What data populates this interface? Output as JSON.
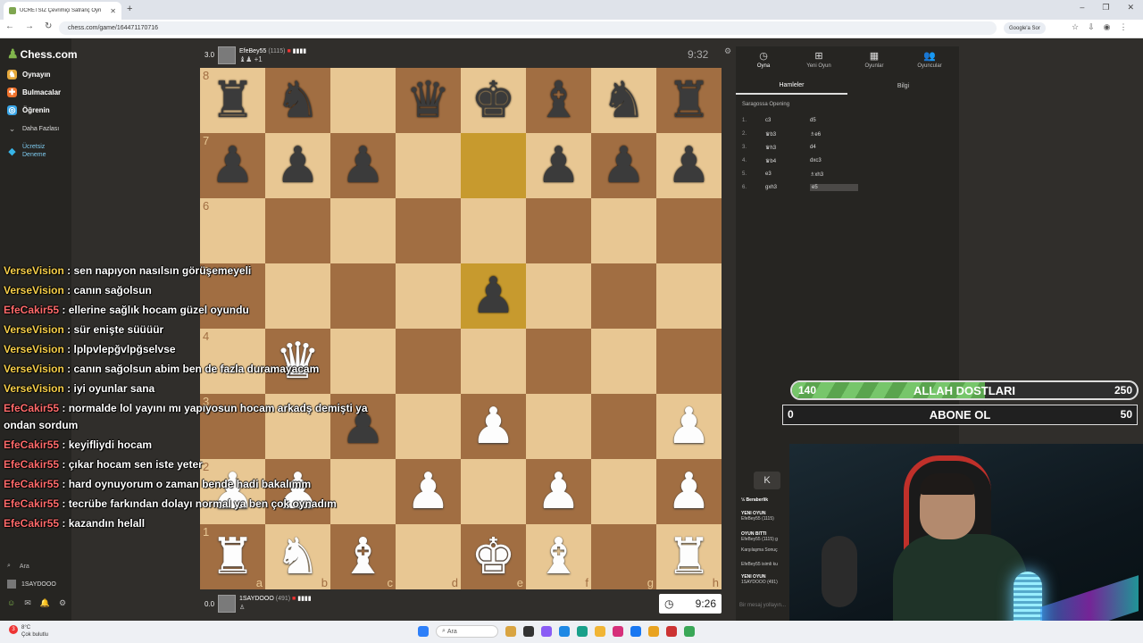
{
  "browser": {
    "tab_title": "ÜCRETSİZ Çevrimiçi Satranç Oyn",
    "new_tab": "+",
    "url": "chess.com/game/164471170716",
    "google_button": "Google'a Sor",
    "window_controls": [
      "–",
      "❐",
      "✕"
    ]
  },
  "sidebar": {
    "logo": "Chess.com",
    "items": [
      {
        "label": "Oynayın",
        "icon": "play-icon",
        "color": "#e5a93c"
      },
      {
        "label": "Bulmacalar",
        "icon": "puzzle-icon",
        "color": "#f0732d"
      },
      {
        "label": "Öğrenin",
        "icon": "learn-icon",
        "color": "#39a6e8"
      },
      {
        "label": "Daha Fazlası",
        "icon": "chevron-down-icon",
        "color": "#777777"
      },
      {
        "label": "Ücretsiz Deneme",
        "icon": "diamond-icon",
        "color": "#37b5e8"
      }
    ],
    "search": "Ara",
    "username": "1SAYDOOO"
  },
  "top_player": {
    "eval": "3.0",
    "name": "EfeBey55",
    "rating": "(1115)",
    "captured": "♝♟ +1",
    "clock": "9:32"
  },
  "bottom_player": {
    "eval": "0.0",
    "name": "1SAYDOOO",
    "rating": "(491)",
    "clock": "9:26"
  },
  "board": {
    "ranks": [
      "8",
      "7",
      "6",
      "5",
      "4",
      "3",
      "2",
      "1"
    ],
    "files": [
      "a",
      "b",
      "c",
      "d",
      "e",
      "f",
      "g",
      "h"
    ],
    "highlight": [
      "e7",
      "e5"
    ],
    "position": [
      [
        "bR",
        "bN",
        "",
        "bQ",
        "bK",
        "bB",
        "bN",
        "bR"
      ],
      [
        "bP",
        "bP",
        "bP",
        "",
        "",
        "bP",
        "bP",
        "bP"
      ],
      [
        "",
        "",
        "",
        "",
        "",
        "",
        "",
        ""
      ],
      [
        "",
        "",
        "",
        "",
        "bP",
        "",
        "",
        ""
      ],
      [
        "",
        "wQ",
        "",
        "",
        "",
        "",
        "",
        ""
      ],
      [
        "",
        "",
        "bP",
        "",
        "wP",
        "",
        "",
        "wP"
      ],
      [
        "wP",
        "wP",
        "",
        "wP",
        "",
        "wP",
        "",
        "wP"
      ],
      [
        "wR",
        "wN",
        "wB",
        "",
        "wK",
        "wB",
        "",
        "wR"
      ]
    ]
  },
  "right_panel": {
    "tabs": [
      {
        "label": "Oyna",
        "icon": "clock-icon"
      },
      {
        "label": "Yeni Oyun",
        "icon": "plus-icon"
      },
      {
        "label": "Oyunlar",
        "icon": "grid-icon"
      },
      {
        "label": "Oyuncular",
        "icon": "users-icon"
      }
    ],
    "subtabs": [
      "Hamleler",
      "Bilgi"
    ],
    "opening": "Saragossa Opening",
    "moves": [
      {
        "n": "1.",
        "w": "c3",
        "b": "d5"
      },
      {
        "n": "2.",
        "w": "♛b3",
        "b": "♗e6"
      },
      {
        "n": "3.",
        "w": "♛h3",
        "b": "d4"
      },
      {
        "n": "4.",
        "w": "♛b4",
        "b": "dxc3"
      },
      {
        "n": "5.",
        "w": "e3",
        "b": "♗xh3"
      },
      {
        "n": "6.",
        "w": "gxh3",
        "b": "e5"
      }
    ],
    "first_button": "K",
    "log": [
      {
        "head": "½ Beraberlik",
        "text": ""
      },
      {
        "head": "YENİ OYUN",
        "text": "EfeBey55 (1115)"
      },
      {
        "head": "OYUN BİTTİ",
        "text": "EfeBey55 (1115) g"
      },
      {
        "head": "",
        "text": "Karşılaşma Sonuç"
      },
      {
        "head": "",
        "text": "EfeBey55 isimli ku"
      },
      {
        "head": "YENİ OYUN",
        "text": "1SAYDOOO (491)"
      }
    ],
    "message_placeholder": "Bir mesaj yollayın..."
  },
  "overlay": {
    "goal1": {
      "start": "140",
      "title": "ALLAH DOSTLARI",
      "goal": "250",
      "progress": 0.56
    },
    "goal2": {
      "start": "0",
      "title": "ABONE OL",
      "goal": "50",
      "progress": 0
    }
  },
  "chat": [
    {
      "user": "VerseVision",
      "msg": "sen napıyon nasılsın görüşemeyeli",
      "color": "u1"
    },
    {
      "user": "VerseVision",
      "msg": "canın sağolsun",
      "color": "u1"
    },
    {
      "user": "EfeCakir55",
      "msg": "ellerine sağlık hocam güzel oyundu",
      "color": "u2"
    },
    {
      "user": "VerseVision",
      "msg": "sür enişte süüüür",
      "color": "u1"
    },
    {
      "user": "VerseVision",
      "msg": "lplpvlepğvlpğselvse",
      "color": "u1"
    },
    {
      "user": "VerseVision",
      "msg": "canın sağolsun abim ben de fazla duramayacam",
      "color": "u1"
    },
    {
      "user": "VerseVision",
      "msg": "iyi oyunlar sana",
      "color": "u1"
    },
    {
      "user": "EfeCakir55",
      "msg": "normalde lol yayını mı yapıyosun hocam arkadş demişti ya",
      "color": "u2",
      "cont": "ondan sordum"
    },
    {
      "user": "EfeCakir55",
      "msg": "keyifliydi hocam",
      "color": "u2"
    },
    {
      "user": "EfeCakir55",
      "msg": "çıkar hocam sen iste yeter",
      "color": "u2"
    },
    {
      "user": "EfeCakir55",
      "msg": "hard oynuyorum o zaman bende hadi bakalımm",
      "color": "u2"
    },
    {
      "user": "EfeCakir55",
      "msg": "tecrübe farkından dolayı normal ya ben çok oynadım",
      "color": "u2"
    },
    {
      "user": "EfeCakir55",
      "msg": "kazandın helall",
      "color": "u2"
    }
  ],
  "taskbar": {
    "weather_temp": "8°C",
    "weather_text": "Çok bulutlu",
    "search": "Ara"
  }
}
